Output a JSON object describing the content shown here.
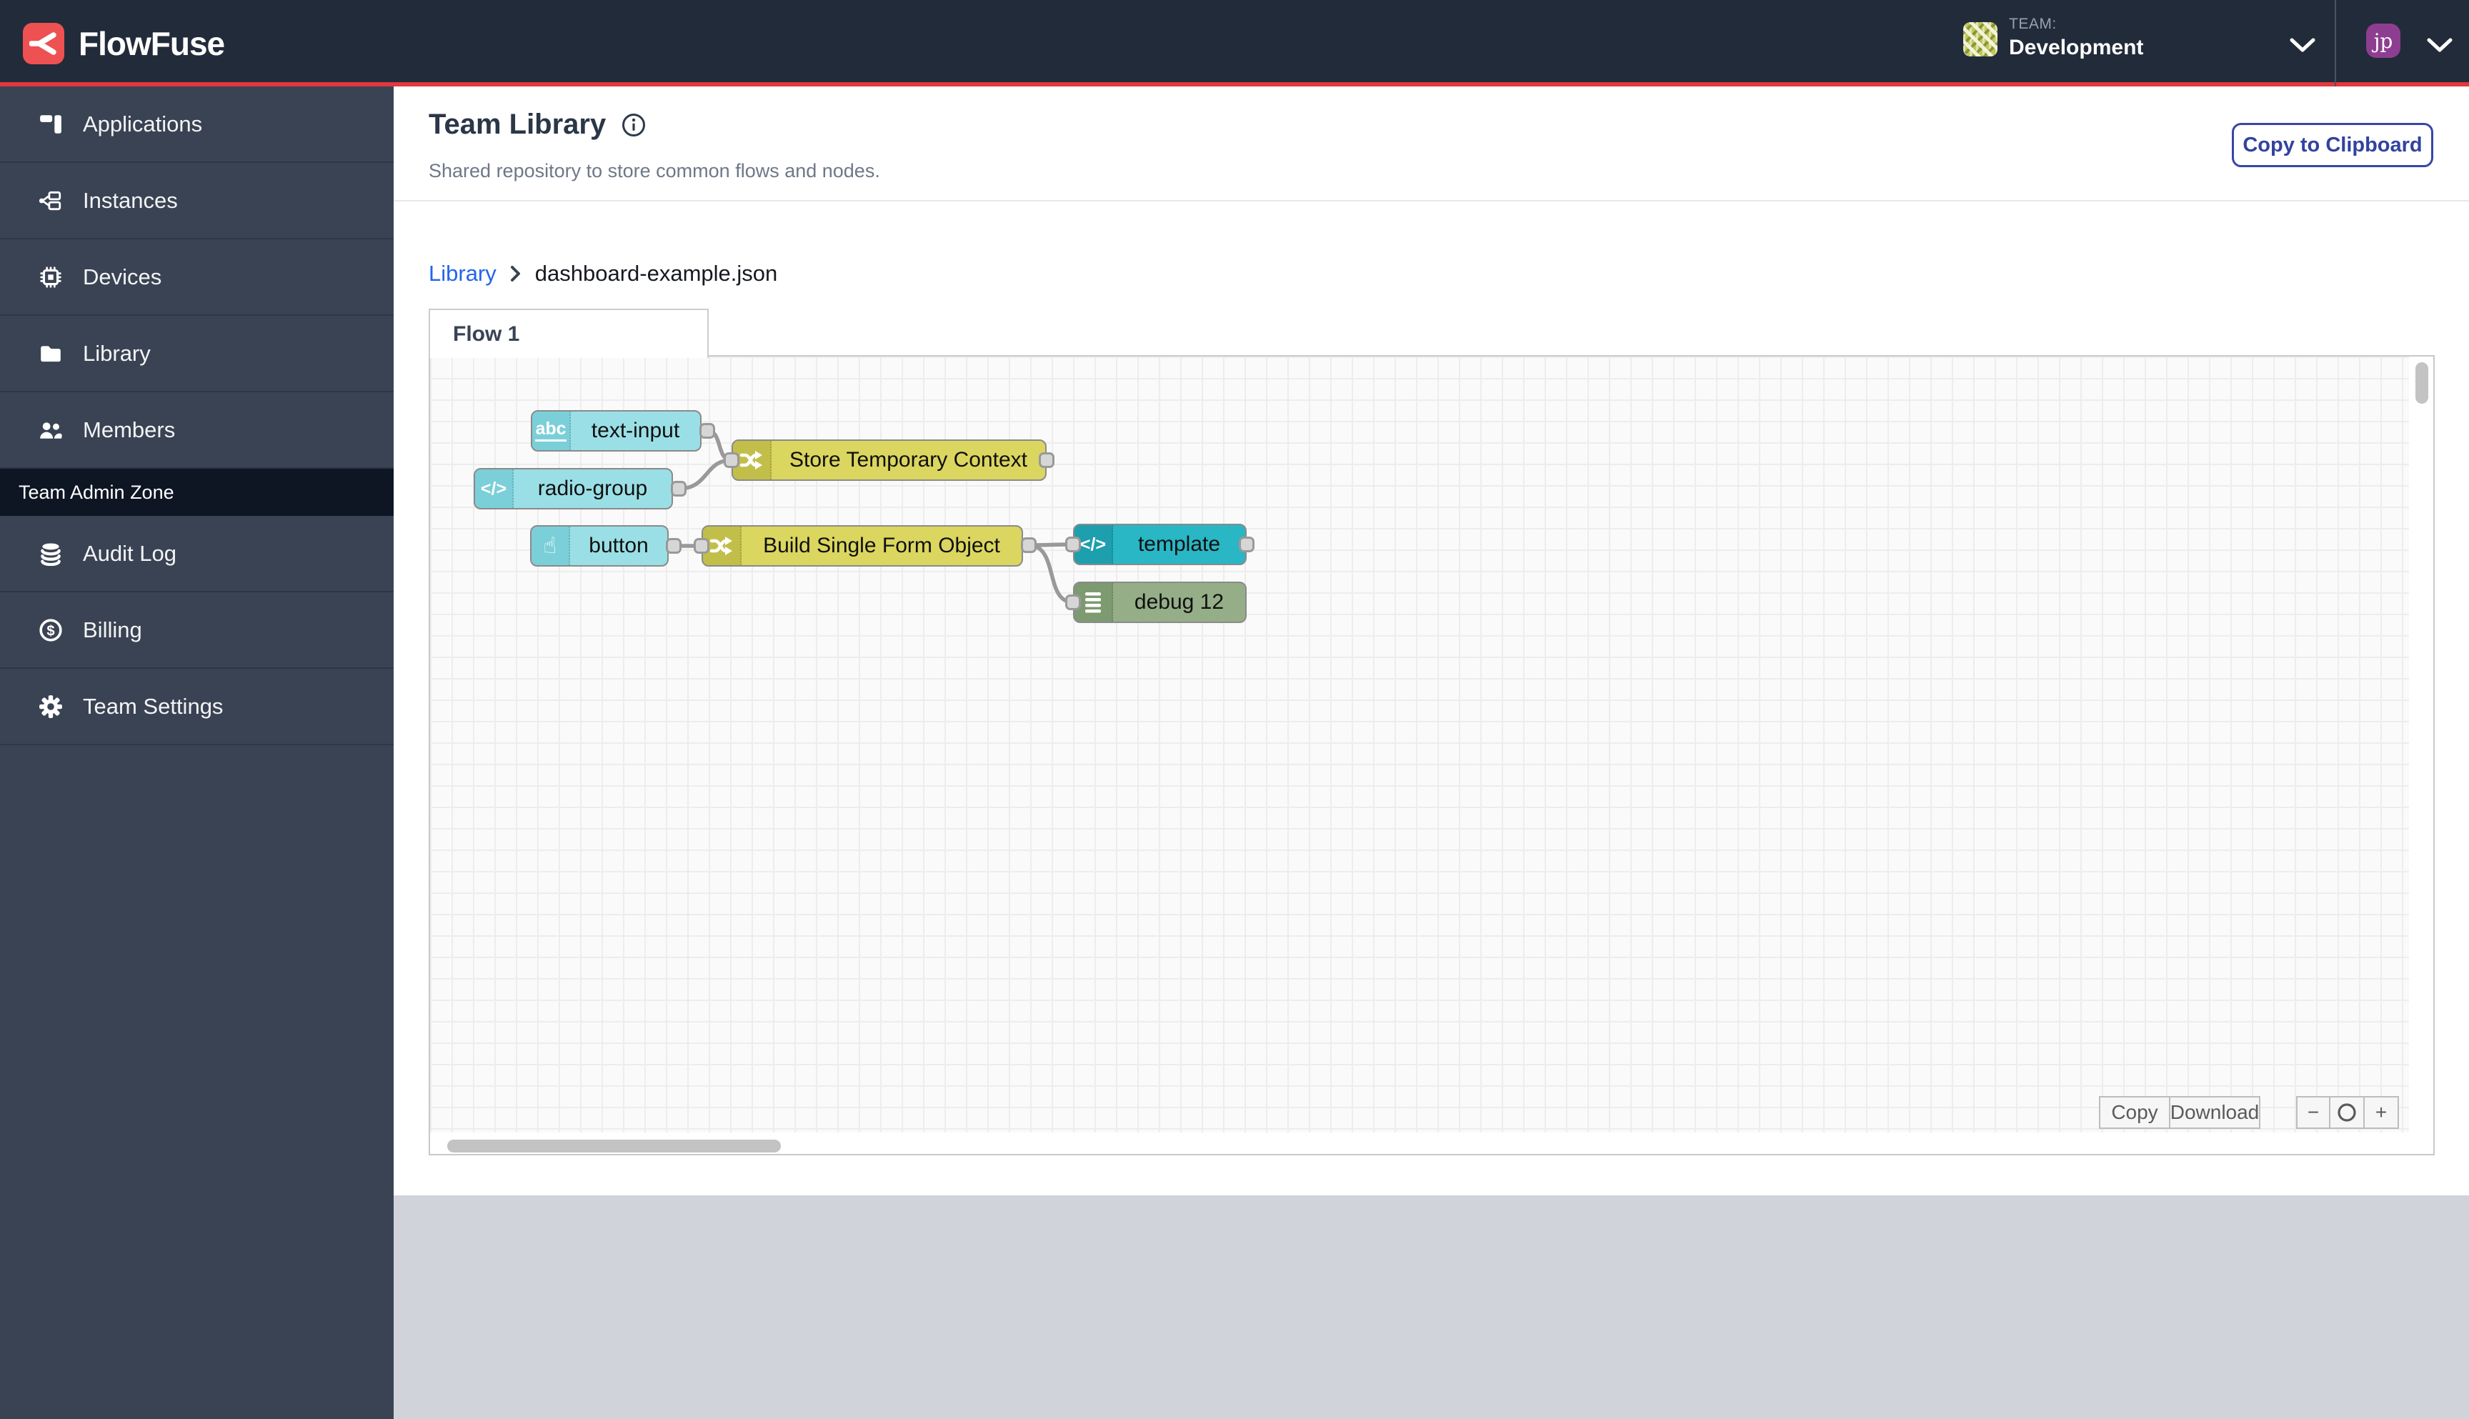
{
  "brand": {
    "name": "FlowFuse"
  },
  "header": {
    "team_label": "TEAM:",
    "team_name": "Development",
    "user_initials": "jp"
  },
  "sidebar": {
    "items": [
      {
        "label": "Applications",
        "icon": "applications-icon"
      },
      {
        "label": "Instances",
        "icon": "instances-icon"
      },
      {
        "label": "Devices",
        "icon": "devices-icon"
      },
      {
        "label": "Library",
        "icon": "library-icon"
      },
      {
        "label": "Members",
        "icon": "members-icon"
      }
    ],
    "admin_zone_label": "Team Admin Zone",
    "admin_items": [
      {
        "label": "Audit Log",
        "icon": "audit-log-icon"
      },
      {
        "label": "Billing",
        "icon": "billing-icon"
      },
      {
        "label": "Team Settings",
        "icon": "settings-icon"
      }
    ]
  },
  "page": {
    "title": "Team Library",
    "subtitle": "Shared repository to store common flows and nodes.",
    "copy_to_clipboard": "Copy to Clipboard"
  },
  "breadcrumb": {
    "parent": "Library",
    "current": "dashboard-example.json"
  },
  "flow_tab": "Flow 1",
  "flow": {
    "nodes": [
      {
        "label": "text-input",
        "type": "ui-text-input",
        "color": "#9bdfe6"
      },
      {
        "label": "radio-group",
        "type": "ui-radio-group",
        "color": "#9bdfe6"
      },
      {
        "label": "Store Temporary Context",
        "type": "change",
        "color": "#dbd65f"
      },
      {
        "label": "button",
        "type": "ui-button",
        "color": "#9bdfe6"
      },
      {
        "label": "Build Single Form Object",
        "type": "change",
        "color": "#dbd65f"
      },
      {
        "label": "template",
        "type": "template",
        "color": "#29b6c5"
      },
      {
        "label": "debug 12",
        "type": "debug",
        "color": "#95ae87"
      }
    ],
    "wires": [
      "text-input -> Store Temporary Context",
      "radio-group -> Store Temporary Context",
      "button -> Build Single Form Object",
      "Build Single Form Object -> template",
      "Build Single Form Object -> debug 12"
    ]
  },
  "canvas_controls": {
    "copy": "Copy",
    "download": "Download",
    "zoom_out": "−",
    "zoom_in": "+"
  },
  "colors": {
    "accent_red": "#e0393e",
    "header_bg": "#222b3a",
    "sidebar_bg": "#3a4353",
    "link_blue": "#2563eb",
    "button_blue": "#32429f",
    "node_cyan": "#9bdfe6",
    "node_yellow": "#dbd65f",
    "node_teal": "#29b6c5",
    "node_green": "#95ae87"
  }
}
